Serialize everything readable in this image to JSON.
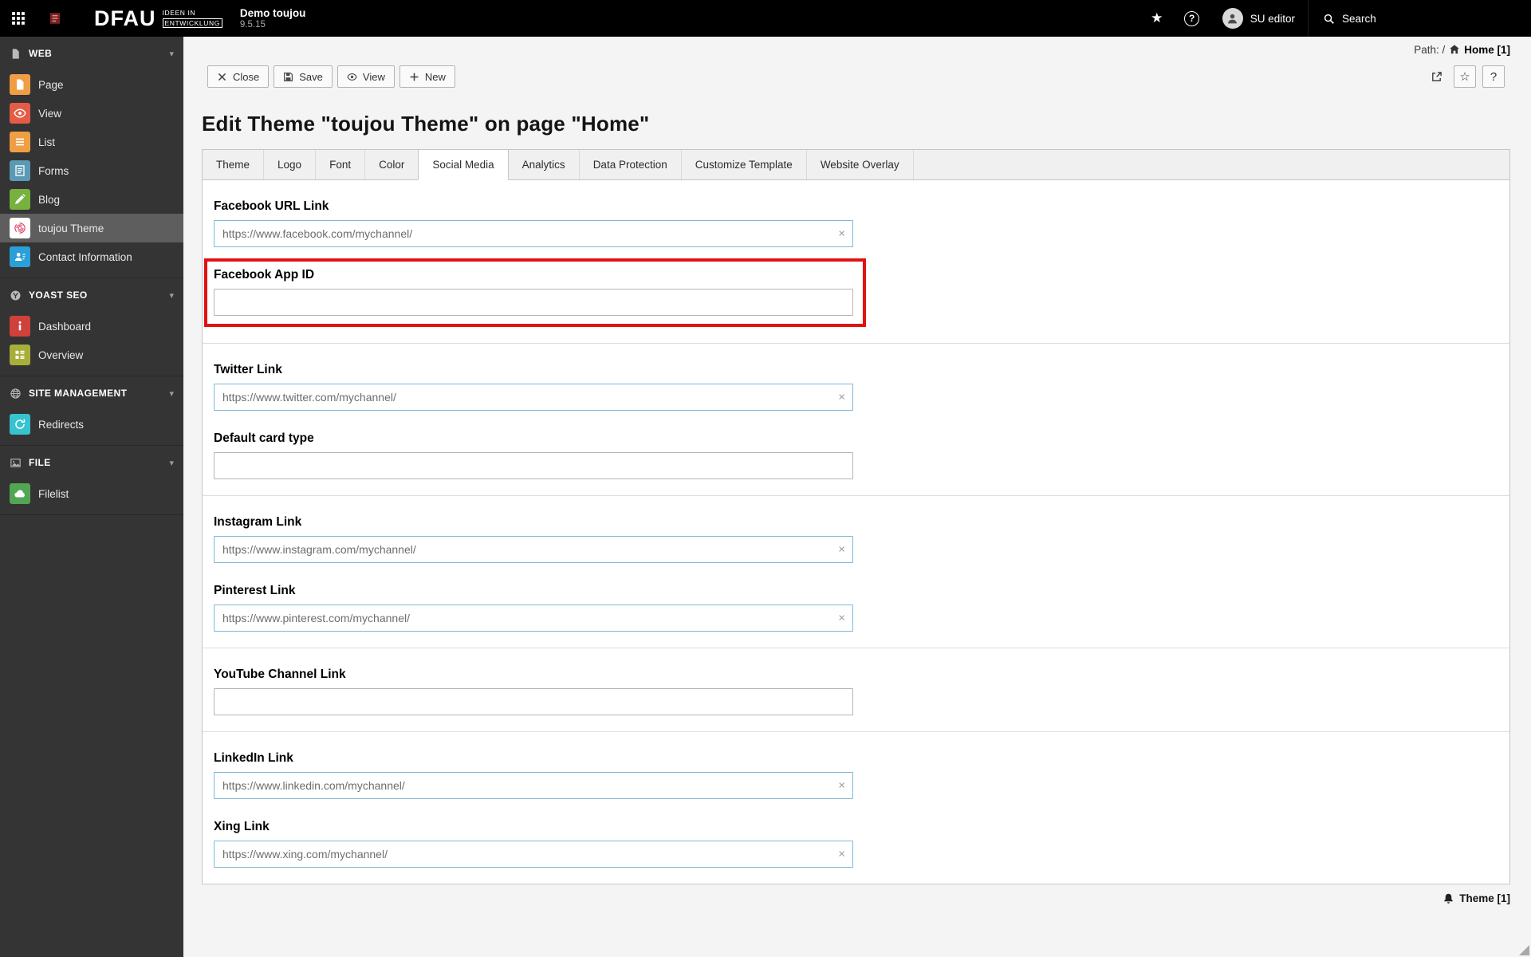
{
  "topbar": {
    "logo": {
      "text": "DFAU",
      "tagline_line1": "IDEEN IN",
      "tagline_line2": "ENTWICKLUNG"
    },
    "site_name": "Demo toujou",
    "version": "9.5.15",
    "user_label": "SU editor",
    "search_label": "Search"
  },
  "sidebar": {
    "sections": [
      {
        "label": "WEB",
        "icon": "web-section-icon",
        "items": [
          {
            "label": "Page",
            "icon": "page-icon",
            "color": "#ef9e44"
          },
          {
            "label": "View",
            "icon": "view-icon",
            "color": "#e45c45"
          },
          {
            "label": "List",
            "icon": "list-icon",
            "color": "#ef9e44"
          },
          {
            "label": "Forms",
            "icon": "forms-icon",
            "color": "#5b9ab5"
          },
          {
            "label": "Blog",
            "icon": "blog-icon",
            "color": "#77b13e"
          },
          {
            "label": "toujou Theme",
            "icon": "theme-icon",
            "color": "#ffffff",
            "selected": true
          },
          {
            "label": "Contact Information",
            "icon": "contact-icon",
            "color": "#2a9fd8"
          }
        ]
      },
      {
        "label": "YOAST SEO",
        "icon": "yoast-section-icon",
        "items": [
          {
            "label": "Dashboard",
            "icon": "dashboard-icon",
            "color": "#d0413b"
          },
          {
            "label": "Overview",
            "icon": "overview-icon",
            "color": "#a7af39"
          }
        ]
      },
      {
        "label": "SITE MANAGEMENT",
        "icon": "site-management-section-icon",
        "items": [
          {
            "label": "Redirects",
            "icon": "redirects-icon",
            "color": "#36c3cf"
          }
        ]
      },
      {
        "label": "FILE",
        "icon": "file-section-icon",
        "items": [
          {
            "label": "Filelist",
            "icon": "filelist-icon",
            "color": "#52a552"
          }
        ]
      }
    ]
  },
  "breadcrumb": {
    "path_label": "Path: /",
    "page_ref": "Home [1]"
  },
  "docheader": {
    "buttons": [
      {
        "label": "Close",
        "icon": "close-icon"
      },
      {
        "label": "Save",
        "icon": "save-icon"
      },
      {
        "label": "View",
        "icon": "eye-icon"
      },
      {
        "label": "New",
        "icon": "new-icon"
      }
    ]
  },
  "page_title": "Edit Theme \"toujou Theme\" on page \"Home\"",
  "tabs": [
    {
      "label": "Theme"
    },
    {
      "label": "Logo"
    },
    {
      "label": "Font"
    },
    {
      "label": "Color"
    },
    {
      "label": "Social Media",
      "active": true
    },
    {
      "label": "Analytics"
    },
    {
      "label": "Data Protection"
    },
    {
      "label": "Customize Template"
    },
    {
      "label": "Website Overlay"
    }
  ],
  "form": {
    "sections": [
      {
        "fields": [
          {
            "label": "Facebook URL Link",
            "value": "https://www.facebook.com/mychannel/",
            "clearable": true
          },
          {
            "label": "Facebook App ID",
            "value": "",
            "highlighted": true
          }
        ]
      },
      {
        "fields": [
          {
            "label": "Twitter Link",
            "value": "https://www.twitter.com/mychannel/",
            "clearable": true
          },
          {
            "label": "Default card type",
            "value": ""
          }
        ]
      },
      {
        "fields": [
          {
            "label": "Instagram Link",
            "value": "https://www.instagram.com/mychannel/",
            "clearable": true
          },
          {
            "label": "Pinterest Link",
            "value": "https://www.pinterest.com/mychannel/",
            "clearable": true
          }
        ]
      },
      {
        "fields": [
          {
            "label": "YouTube Channel Link",
            "value": ""
          }
        ]
      },
      {
        "fields": [
          {
            "label": "LinkedIn Link",
            "value": "https://www.linkedin.com/mychannel/",
            "clearable": true
          },
          {
            "label": "Xing Link",
            "value": "https://www.xing.com/mychannel/",
            "clearable": true
          }
        ]
      }
    ]
  },
  "footer": {
    "record_ref": "Theme [1]"
  },
  "colors": {
    "annotation_red": "#e01212",
    "input_filled_border": "#7eb8d9",
    "topbar_bg": "#000000",
    "sidebar_bg": "#343434",
    "selected_item_bg": "#5e5e5e"
  }
}
